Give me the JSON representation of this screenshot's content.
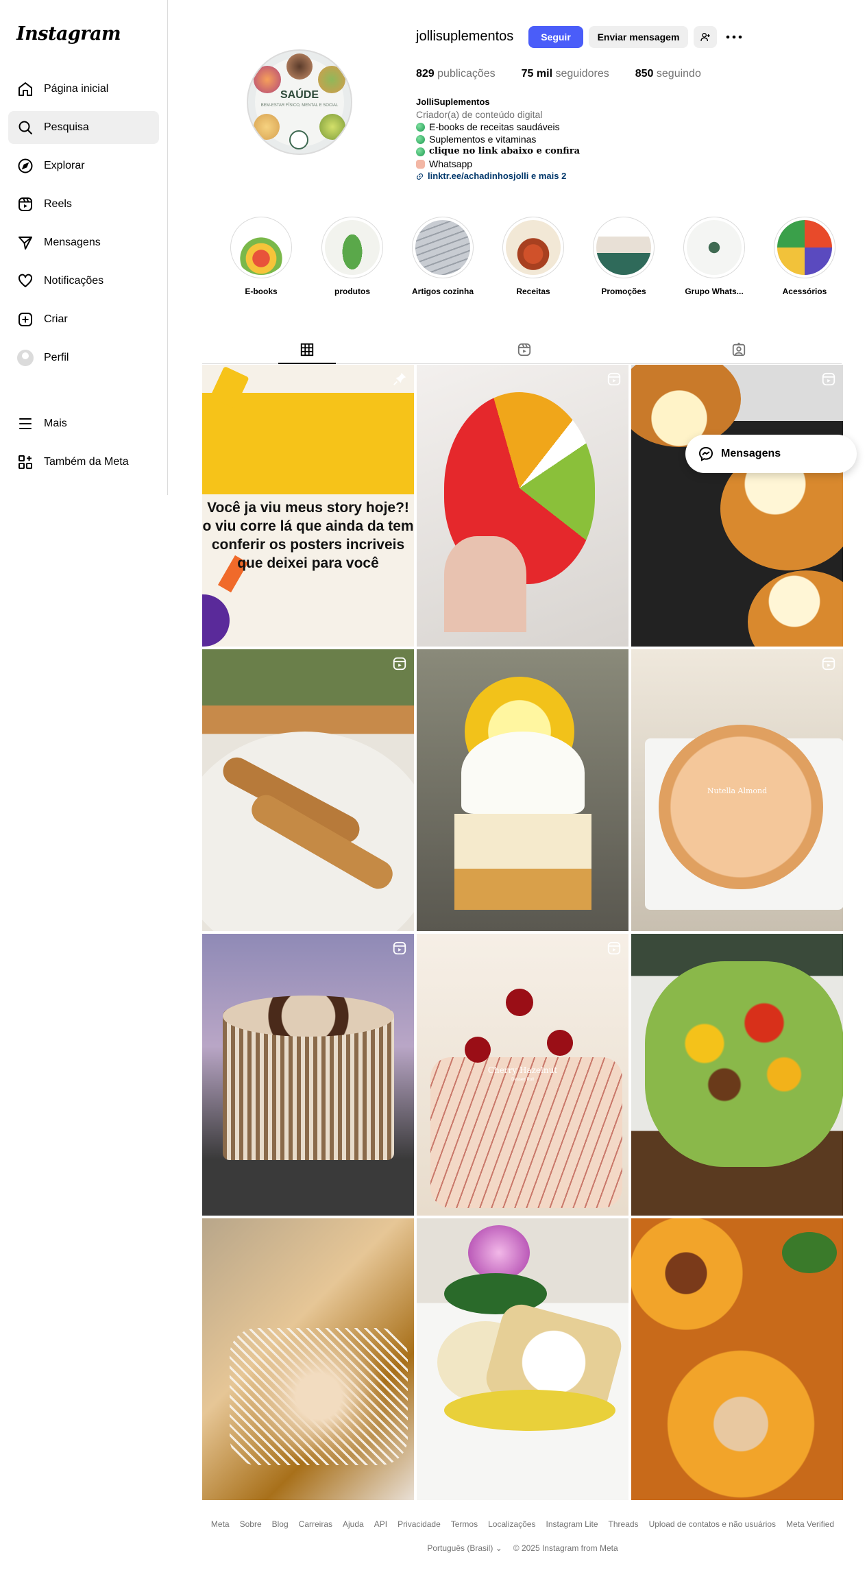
{
  "app": {
    "logo": "Instagram"
  },
  "sidebar": {
    "items": [
      {
        "label": "Página inicial",
        "icon": "home-icon"
      },
      {
        "label": "Pesquisa",
        "icon": "search-icon"
      },
      {
        "label": "Explorar",
        "icon": "compass-icon"
      },
      {
        "label": "Reels",
        "icon": "reels-icon"
      },
      {
        "label": "Mensagens",
        "icon": "send-icon"
      },
      {
        "label": "Notificações",
        "icon": "heart-icon"
      },
      {
        "label": "Criar",
        "icon": "plus-square-icon"
      },
      {
        "label": "Perfil",
        "icon": "avatar"
      },
      {
        "label": "Mais",
        "icon": "menu-icon"
      },
      {
        "label": "Também da Meta",
        "icon": "meta-grid-icon"
      }
    ]
  },
  "profile": {
    "picture_title": "SAÚDE",
    "picture_subtitle": "BEM-ESTAR FÍSICO, MENTAL E SOCIAL",
    "username": "jollisuplementos",
    "follow_label": "Seguir",
    "message_label": "Enviar mensagem",
    "stats": {
      "posts_value": "829",
      "posts_label": "publicações",
      "followers_value": "75 mil",
      "followers_label": "seguidores",
      "following_value": "850",
      "following_label": "seguindo"
    },
    "bio": {
      "name": "JolliSuplementos",
      "category": "Criador(a) de conteúdo digital",
      "lines": [
        "E-books de receitas saudáveis",
        "Suplementos e vitaminas",
        "clique no link abaixo e confira",
        "Whatsapp"
      ],
      "link": "linktr.ee/achadinhosjolli e mais 2"
    }
  },
  "highlights": [
    {
      "label": "E-books"
    },
    {
      "label": "produtos"
    },
    {
      "label": "Artigos cozinha"
    },
    {
      "label": "Receitas"
    },
    {
      "label": "Promoções"
    },
    {
      "label": "Grupo Whats..."
    },
    {
      "label": "Acessórios"
    }
  ],
  "posts": {
    "first_post_text": "Você ja viu meus story hoje?! o viu corre lá que ainda da tem conferir os posters incriveis que deixei para você",
    "post_overlay_text_1": "Nutella Almond",
    "post_overlay_text_2": "Cherry Hazelnut",
    "post_overlay_subtext_2": "Dessert Roll"
  },
  "floating": {
    "messages_label": "Mensagens"
  },
  "footer": {
    "links": [
      "Meta",
      "Sobre",
      "Blog",
      "Carreiras",
      "Ajuda",
      "API",
      "Privacidade",
      "Termos",
      "Localizações",
      "Instagram Lite",
      "Threads",
      "Upload de contatos e não usuários",
      "Meta Verified"
    ],
    "language": "Português (Brasil)",
    "copyright": "© 2025 Instagram from Meta"
  }
}
